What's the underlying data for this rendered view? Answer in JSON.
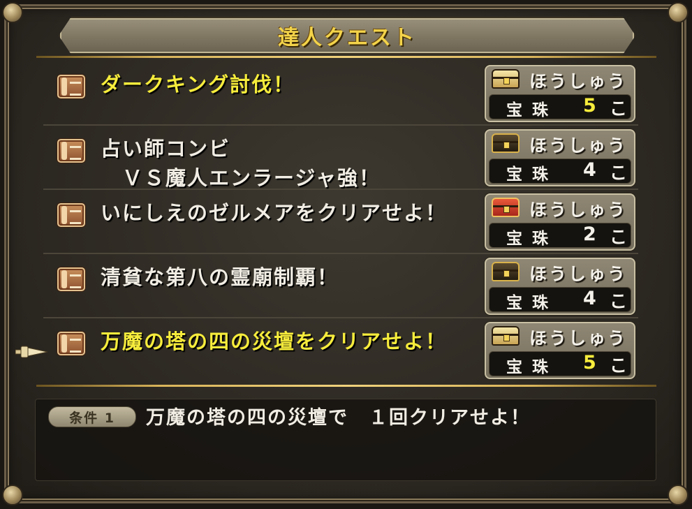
{
  "window": {
    "title": "達人クエスト"
  },
  "quests": [
    {
      "name": "ダークキング討伐！",
      "highlight": true,
      "chest": "gold",
      "reward_label": "ほうしゅう",
      "item": "宝珠",
      "qty": "5",
      "unit": "こ",
      "qty_highlight": true
    },
    {
      "name": "占い師コンビ\n　ＶＳ魔人エンラージャ強！",
      "highlight": false,
      "chest": "black",
      "reward_label": "ほうしゅう",
      "item": "宝珠",
      "qty": "4",
      "unit": "こ",
      "qty_highlight": false
    },
    {
      "name": "いにしえのゼルメアをクリアせよ！",
      "highlight": false,
      "chest": "red",
      "reward_label": "ほうしゅう",
      "item": "宝珠",
      "qty": "2",
      "unit": "こ",
      "qty_highlight": false
    },
    {
      "name": "清貧な第八の霊廟制覇！",
      "highlight": false,
      "chest": "black",
      "reward_label": "ほうしゅう",
      "item": "宝珠",
      "qty": "4",
      "unit": "こ",
      "qty_highlight": false
    },
    {
      "name": "万魔の塔の四の災壇をクリアせよ！",
      "highlight": true,
      "chest": "gold",
      "reward_label": "ほうしゅう",
      "item": "宝珠",
      "qty": "5",
      "unit": "こ",
      "qty_highlight": true
    }
  ],
  "selected_quest": 4,
  "condition": {
    "badge": "条件 1",
    "text": "万魔の塔の四の災壇で　１回クリアせよ！"
  }
}
